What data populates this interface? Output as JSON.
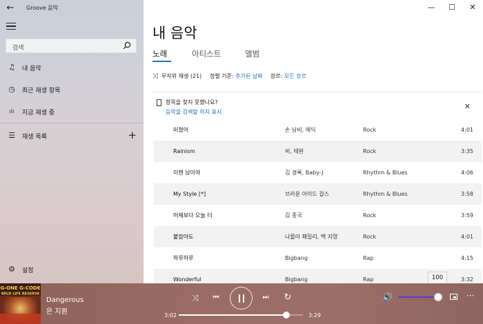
{
  "window": {
    "app_title": "Groove 음악",
    "back_glyph": "←",
    "minimize_glyph": "—",
    "maximize_glyph": "☐",
    "close_glyph": "✕"
  },
  "sidebar": {
    "search_placeholder": "검색",
    "items": [
      {
        "label": "내 음악",
        "icon": "music-note-icon",
        "glyph": "♫"
      },
      {
        "label": "최근 재생 항목",
        "icon": "clock-icon",
        "glyph": "◷"
      },
      {
        "label": "지금 재생 중",
        "icon": "now-playing-bars-icon",
        "glyph": "ılı"
      },
      {
        "label": "재생 목록",
        "icon": "playlist-icon",
        "glyph": "☰"
      },
      {
        "label": "설정",
        "icon": "gear-icon",
        "glyph": "⚙"
      }
    ],
    "add_glyph": "+"
  },
  "main": {
    "title": "내 음악",
    "tabs": [
      {
        "label": "노래",
        "active": true
      },
      {
        "label": "아티스트",
        "active": false
      },
      {
        "label": "앨범",
        "active": false
      }
    ],
    "toolbar": {
      "shuffle_glyph": "⤨",
      "shuffle_label": "무작위 재생 (21)",
      "sort_label": "정렬 기준:",
      "sort_value": "추가된 날짜",
      "genre_label": "장르:",
      "genre_value": "모든 장르"
    },
    "banner": {
      "line1": "항목을 찾지 못했나요?",
      "line2": "음악을 검색할 위치 표시",
      "close_glyph": "✕"
    },
    "songs": [
      {
        "title": "미쳤어",
        "artist": "손 남비, 에딕",
        "genre": "Rock",
        "duration": "4:01"
      },
      {
        "title": "Rainism",
        "artist": "비, 태완",
        "genre": "Rock",
        "duration": "3:35"
      },
      {
        "title": "이젠 남이야",
        "artist": "김 경록, Baby-J",
        "genre": "Rhythm & Blues",
        "duration": "4:06"
      },
      {
        "title": "My Style [*]",
        "artist": "브라운 아이드 걸스",
        "genre": "Rhythm & Blues",
        "duration": "3:58"
      },
      {
        "title": "어제보다 오늘 더",
        "artist": "김 종국",
        "genre": "Rock",
        "duration": "3:59"
      },
      {
        "title": "붙잡아도",
        "artist": "나몰라 패밀리, 백 지영",
        "genre": "Rock",
        "duration": "4:01"
      },
      {
        "title": "하루하루",
        "artist": "Bigbang",
        "genre": "Rap",
        "duration": "4:15"
      },
      {
        "title": "Wonderful",
        "artist": "Bigbang",
        "genre": "Rap",
        "duration": "3:32"
      }
    ]
  },
  "player": {
    "track_title": "Dangerous",
    "artist": "은 지원",
    "album_art_text": "G-ONE G-CODE WILD LIFE RESERVE",
    "current_time": "3:02",
    "total_time": "3:29",
    "progress_fraction": 0.868,
    "volume_tooltip": "100",
    "controls": {
      "shuffle": "⤨",
      "previous": "⏮",
      "next": "⏭",
      "repeat": "↻",
      "volume": "🔊",
      "more": "···"
    },
    "colors": {
      "accent": "#1f6cb8",
      "volume_track": "#5a3bd0"
    }
  }
}
